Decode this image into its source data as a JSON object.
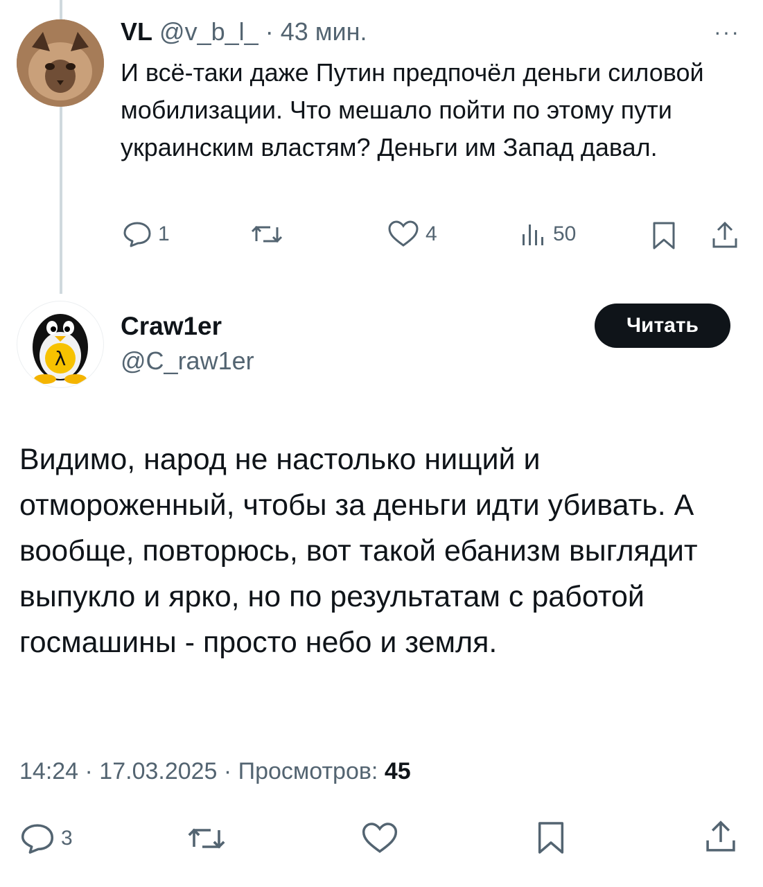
{
  "reply": {
    "display_name": "VL",
    "handle": "@v_b_l_",
    "separator": "·",
    "time": "43 мин.",
    "more_label": "···",
    "text": "И всё-таки даже Путин предпочёл деньги силовой мобилизации. Что мешало пойти по этому пути украинским властям? Деньги им Запад давал.",
    "actions": {
      "replies": "1",
      "retweets": "",
      "likes": "4",
      "views": "50"
    }
  },
  "main": {
    "display_name": "Craw1er",
    "handle": "@C_raw1er",
    "follow_label": "Читать",
    "text": "Видимо, народ не настолько нищий и отмороженный, чтобы за деньги идти убивать. А вообще, повторюсь, вот такой ебанизм выглядит выпукло и ярко, но по результатам с работой госмашины - просто небо и земля.",
    "timestamp": "14:24 · 17.03.2025 · Просмотров: ",
    "views": "45",
    "actions": {
      "replies": "3"
    }
  },
  "icons": {
    "reply": "reply-icon",
    "retweet": "retweet-icon",
    "like": "heart-icon",
    "views": "views-chart-icon",
    "bookmark": "bookmark-icon",
    "share": "share-icon"
  },
  "colors": {
    "text": "#0f1419",
    "secondary": "#536471",
    "thread_line": "#cfd9de",
    "button": "#0f1419"
  }
}
